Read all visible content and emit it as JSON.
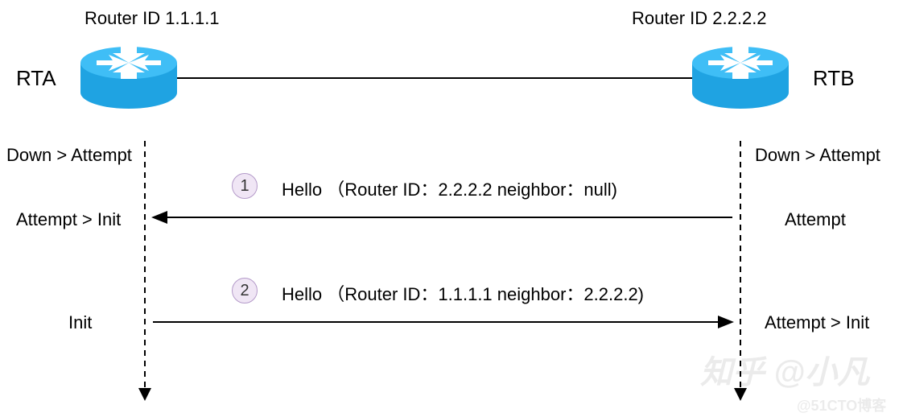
{
  "routerA": {
    "id_label": "Router ID 1.1.1.1",
    "name": "RTA"
  },
  "routerB": {
    "id_label": "Router ID 2.2.2.2",
    "name": "RTB"
  },
  "left_states": {
    "s1": "Down > Attempt",
    "s2": "Attempt > Init",
    "s3": "Init"
  },
  "right_states": {
    "s1": "Down > Attempt",
    "s2": "Attempt",
    "s3": "Attempt > Init"
  },
  "messages": {
    "m1": {
      "num": "1",
      "text": "Hello （Router ID：2.2.2.2 neighbor：null)"
    },
    "m2": {
      "num": "2",
      "text": "Hello （Router ID：1.1.1.1 neighbor：2.2.2.2)"
    }
  },
  "watermark": {
    "main": "知乎 @小凡",
    "sub": "@51CTO博客"
  },
  "colors": {
    "router_blue": "#1fa3e2",
    "step_fill": "#f0e6f5",
    "step_border": "#b49ac9"
  }
}
